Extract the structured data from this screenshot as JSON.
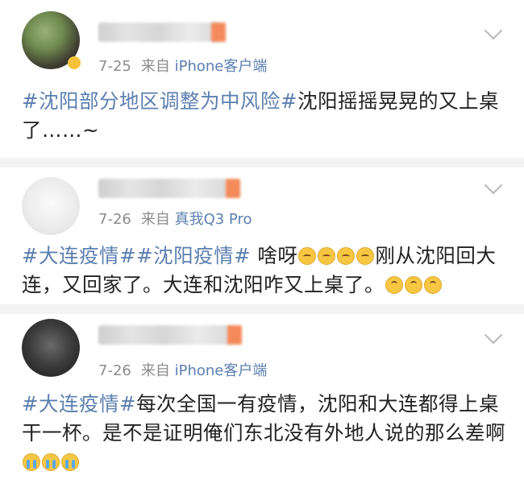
{
  "posts": [
    {
      "date": "7-25",
      "source_prefix": "来自",
      "device": "iPhone客户端",
      "avatar_icon": "user-avatar-blurred",
      "content": {
        "tag1": "#沈阳部分地区调整为中风险#",
        "text1": "沈阳摇摇晃晃的又上桌了……~"
      }
    },
    {
      "date": "7-26",
      "source_prefix": "来自",
      "device": "真我Q3 Pro",
      "avatar_icon": "user-avatar-blurred",
      "content": {
        "tag1": "#大连疫情#",
        "tag2": "#沈阳疫情#",
        "text1": " 啥呀",
        "text2": "刚从沈阳回大连，又回家了。大连和沈阳咋又上桌了。",
        "emoji_sweat": "sweat-smile-emoji",
        "emoji_upside": "upside-down-face-emoji"
      }
    },
    {
      "date": "7-26",
      "source_prefix": "来自",
      "device": "iPhone客户端",
      "avatar_icon": "user-avatar-blurred",
      "content": {
        "tag1": "#大连疫情#",
        "text1": "每次全国一有疫情，沈阳和大连都得上桌干一杯。是不是证明俺们东北没有外地人说的那么差啊",
        "emoji_cry": "loudly-crying-emoji"
      }
    }
  ],
  "colors": {
    "link": "#5b7fb0",
    "meta": "#8c8c8c",
    "divider": "#f2f2f2"
  }
}
